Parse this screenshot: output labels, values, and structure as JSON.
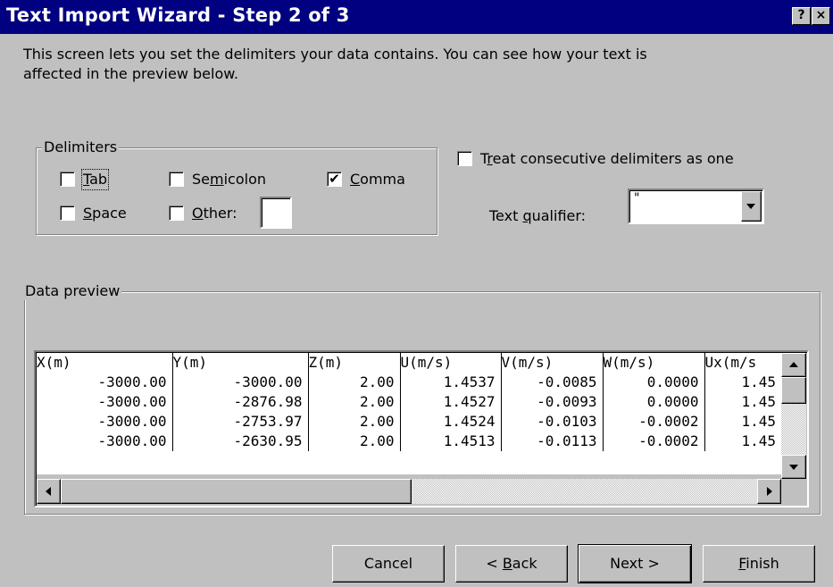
{
  "window": {
    "title": "Text Import Wizard - Step 2 of 3",
    "help_label": "?",
    "close_label": "×"
  },
  "description": "This screen lets you set the delimiters your data contains.  You can see how your text is affected in the preview below.",
  "delimiters": {
    "group_label": "Delimiters",
    "tab": {
      "label_pre": "",
      "label_u": "T",
      "label_post": "ab",
      "checked": false
    },
    "semicolon": {
      "label_pre": "Se",
      "label_u": "m",
      "label_post": "icolon",
      "checked": false
    },
    "comma": {
      "label_pre": "",
      "label_u": "C",
      "label_post": "omma",
      "checked": true
    },
    "space": {
      "label_pre": "",
      "label_u": "S",
      "label_post": "pace",
      "checked": false
    },
    "other": {
      "label_pre": "",
      "label_u": "O",
      "label_post": "ther:",
      "checked": false,
      "value": ""
    }
  },
  "consecutive": {
    "label_pre": "T",
    "label_u": "r",
    "label_post": "eat consecutive delimiters as one",
    "checked": false
  },
  "text_qualifier": {
    "label_pre": "Text ",
    "label_u": "q",
    "label_post": "ualifier:",
    "value": "\""
  },
  "preview": {
    "group_label": "Data preview",
    "headers": [
      "X(m)",
      "Y(m)",
      "Z(m)",
      "U(m/s)",
      "V(m/s)",
      "W(m/s)",
      "Ux(m/s"
    ],
    "rows": [
      [
        "-3000.00",
        "-3000.00",
        "2.00",
        "1.4537",
        "-0.0085",
        "0.0000",
        "1.45"
      ],
      [
        "-3000.00",
        "-2876.98",
        "2.00",
        "1.4527",
        "-0.0093",
        "0.0000",
        "1.45"
      ],
      [
        "-3000.00",
        "-2753.97",
        "2.00",
        "1.4524",
        "-0.0103",
        "-0.0002",
        "1.45"
      ],
      [
        "-3000.00",
        "-2630.95",
        "2.00",
        "1.4513",
        "-0.0113",
        "-0.0002",
        "1.45"
      ]
    ]
  },
  "buttons": {
    "cancel": "Cancel",
    "back_pre": "< ",
    "back_u": "B",
    "back_post": "ack",
    "next": "Next >",
    "finish_u": "F",
    "finish_post": "inish"
  }
}
